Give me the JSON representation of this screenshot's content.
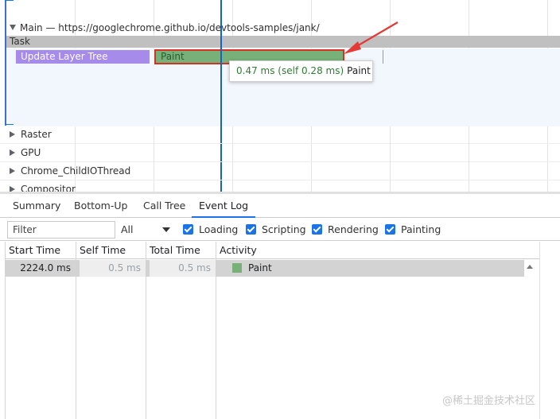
{
  "timeline": {
    "main_track_title": "Main — https://googlechrome.github.io/devtools-samples/jank/",
    "task_label": "Task",
    "update_layer_tree_label": "Update Layer Tree",
    "paint_label": "Paint",
    "tooltip": {
      "time": "0.47 ms (self 0.28 ms)",
      "name": "Paint"
    },
    "threads": [
      "Raster",
      "GPU",
      "Chrome_ChildIOThread",
      "Compositor"
    ],
    "colors": {
      "update_layer_tree": "#a78bea",
      "paint": "#78b07a",
      "highlight_border": "#d93025",
      "cursor": "#1565c0"
    }
  },
  "tabs": [
    "Summary",
    "Bottom-Up",
    "Call Tree",
    "Event Log"
  ],
  "active_tab": "Event Log",
  "toolbar": {
    "filter_placeholder": "Filter",
    "category_select": "All",
    "checkboxes": [
      "Loading",
      "Scripting",
      "Rendering",
      "Painting"
    ]
  },
  "event_log": {
    "columns": [
      "Start Time",
      "Self Time",
      "Total Time",
      "Activity"
    ],
    "rows": [
      {
        "start_time": "2224.0 ms",
        "self_time": "0.5 ms",
        "total_time": "0.5 ms",
        "activity": "Paint"
      }
    ]
  },
  "watermark": "@稀土掘金技术社区"
}
